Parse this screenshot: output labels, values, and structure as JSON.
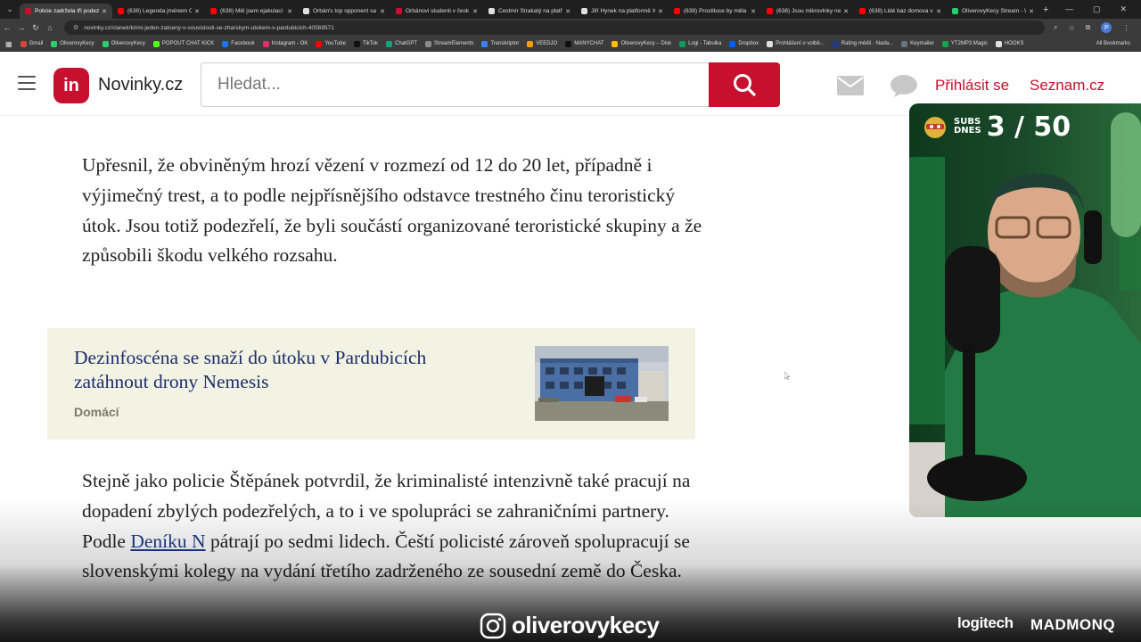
{
  "browser": {
    "tabs": [
      {
        "title": "Policie zadržela tři podezř",
        "color": "#c8102e",
        "active": true
      },
      {
        "title": "(638) Legenda jménem O",
        "color": "#ff0000",
        "active": false
      },
      {
        "title": "(638) Měl jsem ejakulaci z",
        "color": "#ff0000",
        "active": false
      },
      {
        "title": "Orbán's top opponent sa",
        "color": "#e0e0e0",
        "active": false
      },
      {
        "title": "Orbánovi studenti v česk",
        "color": "#c8102e",
        "active": false
      },
      {
        "title": "Čestmír Strakatý na platf",
        "color": "#e0e0e0",
        "active": false
      },
      {
        "title": "Jiří Hynek na platformě X",
        "color": "#e0e0e0",
        "active": false
      },
      {
        "title": "(638) Prostituce by měla",
        "color": "#ff0000",
        "active": false
      },
      {
        "title": "(638) Jsou mikrovlnky ne",
        "color": "#ff0000",
        "active": false
      },
      {
        "title": "(638) Lidé baz domova v",
        "color": "#ff0000",
        "active": false
      },
      {
        "title": "OliverovyKecy Stream - W",
        "color": "#2ecc71",
        "active": false
      }
    ],
    "url": "novinky.cz/clanek/krimi-jeden-zatceny-v-souvislosti-se-zharskym-utokem-v-pardubicich-40569571",
    "bookmarks": [
      {
        "label": "Gmail",
        "color": "#d44638"
      },
      {
        "label": "OliverovyKecy",
        "color": "#2ecc71"
      },
      {
        "label": "OliverovyKecy",
        "color": "#2ecc71"
      },
      {
        "label": "POPOUT CHAT KICK",
        "color": "#53fc18"
      },
      {
        "label": "Facebook",
        "color": "#1877f2"
      },
      {
        "label": "Instagram - OK",
        "color": "#e1306c"
      },
      {
        "label": "YouTube",
        "color": "#ff0000"
      },
      {
        "label": "TikTok",
        "color": "#111111"
      },
      {
        "label": "ChatGPT",
        "color": "#10a37f"
      },
      {
        "label": "StreamElements",
        "color": "#8a8a8a"
      },
      {
        "label": "Transkriptor",
        "color": "#3b82f6"
      },
      {
        "label": "VEEDJO",
        "color": "#f59e0b"
      },
      {
        "label": "MANYCHAT",
        "color": "#111111"
      },
      {
        "label": "OliverovyKecy – Disk",
        "color": "#fbbc04"
      },
      {
        "label": "Logi - Tabulka",
        "color": "#0f9d58"
      },
      {
        "label": "Dropbox",
        "color": "#0061ff"
      },
      {
        "label": "Prohlášení o volbě...",
        "color": "#e0e0e0"
      },
      {
        "label": "Rating médií - Nada...",
        "color": "#1e3a8a"
      },
      {
        "label": "Keymailer",
        "color": "#6b7280"
      },
      {
        "label": "YT2MP3 Magic",
        "color": "#16a34a"
      },
      {
        "label": "HOOKS",
        "color": "#e0e0e0"
      }
    ],
    "all_bookmarks_label": "All Bookmarks"
  },
  "header": {
    "logo_letters": "in",
    "logo_text": "Novinky.cz",
    "search_placeholder": "Hledat...",
    "login_label": "Přihlásit se",
    "seznam_label": "Seznam.cz"
  },
  "article": {
    "paragraph1": "Upřesnil, že obviněným hrozí vězení v rozmezí od 12 do 20 let, případně i výjimečný trest, a to podle nejpřísnějšího odstavce trestného činu teroristický útok. Jsou totiž podezřelí, že byli součástí organizované teroristické skupiny a že způsobili škodu velkého rozsahu.",
    "related": {
      "title": "Dezinfoscéna se snaží do útoku v Pardubicích zatáhnout drony Nemesis",
      "category": "Domácí"
    },
    "paragraph2_before": "Stejně jako policie Štěpánek potvrdil, že kriminalisté intenzivně také pracují na dopadení zbylých podezřelých, a to i ve spolupráci se zahraničními partnery. Podle ",
    "paragraph2_link": "Deníku N",
    "paragraph2_after": " pátrají po sedmi lidech. Čeští policisté zároveň spolupracují se slovenskými kolegy na vydání třetího zadrženého ze sousední země do Česka."
  },
  "overlay": {
    "subs_label_line1": "SUBS",
    "subs_label_line2": "DNES",
    "subs_count": "3 / 50",
    "instagram_handle": "oliverovykecy",
    "sponsor1": "logitech",
    "sponsor2": "MADMONQ"
  }
}
